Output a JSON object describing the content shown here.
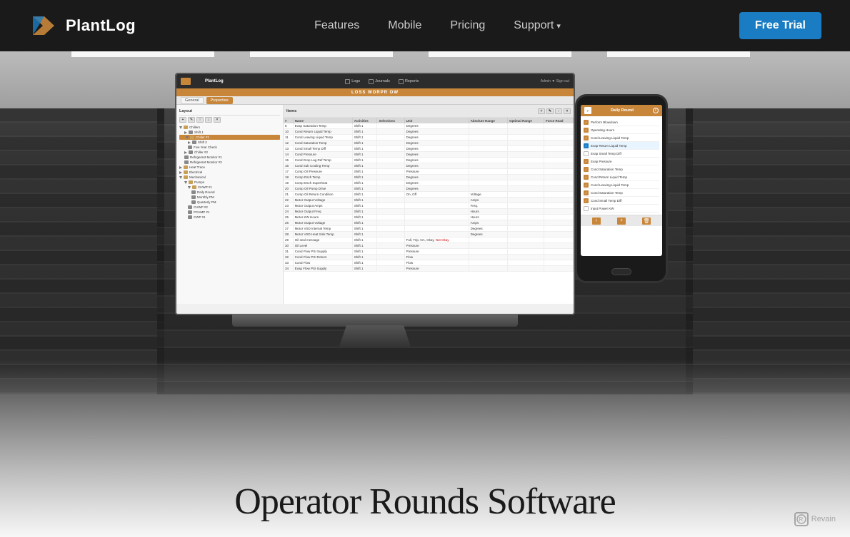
{
  "nav": {
    "logo_text": "PlantLog",
    "links": [
      {
        "label": "Features",
        "id": "features"
      },
      {
        "label": "Mobile",
        "id": "mobile"
      },
      {
        "label": "Pricing",
        "id": "pricing"
      },
      {
        "label": "Support",
        "id": "support"
      }
    ],
    "cta_label": "Free Trial"
  },
  "app": {
    "brand": "PlantLog",
    "nav_items": [
      {
        "label": "Logs",
        "icon": "log-icon"
      },
      {
        "label": "Journals",
        "icon": "journal-icon"
      },
      {
        "label": "Reports",
        "icon": "report-icon"
      }
    ],
    "admin_label": "Admin ▼  Sign out",
    "title_bar": "LOSS WORPR OW",
    "tabs": [
      {
        "label": "General",
        "active": false
      },
      {
        "label": "Properties",
        "active": true
      }
    ],
    "layout_section": "Layout",
    "items_section": "Items",
    "tree": [
      {
        "label": "Chillers",
        "level": 0,
        "type": "folder",
        "open": true
      },
      {
        "label": "Shift 1",
        "level": 1,
        "type": "item"
      },
      {
        "label": "Chiller #1",
        "level": 1,
        "type": "item",
        "selected": true
      },
      {
        "label": "Shift 2",
        "level": 2,
        "type": "item"
      },
      {
        "label": "Five Year Check",
        "level": 2,
        "type": "item"
      },
      {
        "label": "Chiller #2",
        "level": 1,
        "type": "item"
      },
      {
        "label": "Refrigerant Monitor #1",
        "level": 1,
        "type": "item"
      },
      {
        "label": "Refrigerant Monitor #2",
        "level": 1,
        "type": "item"
      },
      {
        "label": "Heat Trace",
        "level": 0,
        "type": "folder"
      },
      {
        "label": "Electrical",
        "level": 0,
        "type": "folder"
      },
      {
        "label": "Mechanical",
        "level": 0,
        "type": "folder"
      },
      {
        "label": "Pumps",
        "level": 1,
        "type": "folder",
        "open": true
      },
      {
        "label": "CHWP #1",
        "level": 2,
        "type": "folder",
        "open": true
      },
      {
        "label": "Daily Round",
        "level": 3,
        "type": "item"
      },
      {
        "label": "Monthly PM",
        "level": 3,
        "type": "item"
      },
      {
        "label": "Quarterly PM",
        "level": 3,
        "type": "item"
      },
      {
        "label": "CHWP #2",
        "level": 2,
        "type": "item"
      },
      {
        "label": "PCHMP #1",
        "level": 2,
        "type": "item"
      },
      {
        "label": "CWP #1",
        "level": 2,
        "type": "item"
      }
    ],
    "table_headers": [
      "#",
      "Name",
      "Activities",
      "Selections",
      "Unit",
      "Absolute Range",
      "Optimal Range",
      "Force Read"
    ],
    "table_rows": [
      [
        "8",
        "Evap Saturation Temp",
        "Shift 1",
        "",
        "Degrees",
        "",
        "",
        ""
      ],
      [
        "10",
        "Cond Return Liquid Temp",
        "Shift 1",
        "",
        "Degrees",
        "",
        "",
        ""
      ],
      [
        "11",
        "Cond Leaving Liquid Temp",
        "Shift 1",
        "",
        "Degrees",
        "",
        "",
        ""
      ],
      [
        "12",
        "Cond Saturation Temp",
        "Shift 1",
        "",
        "Degrees",
        "",
        "",
        ""
      ],
      [
        "13",
        "Cond Small Temp Diff",
        "Shift 1",
        "",
        "Degrees",
        "",
        "",
        ""
      ],
      [
        "14",
        "Cond Pressure",
        "Shift 1",
        "",
        "Degrees",
        "",
        "",
        ""
      ],
      [
        "15",
        "Cond Drop Lag Ref Temp",
        "Shift 1",
        "",
        "Degrees",
        "",
        "",
        ""
      ],
      [
        "16",
        "Cond Sub Cooling Temp",
        "Shift 1",
        "",
        "Degrees",
        "",
        "",
        ""
      ],
      [
        "17",
        "Comp Oil Pressure",
        "Shift 1",
        "",
        "Pressure",
        "",
        "",
        ""
      ],
      [
        "18",
        "Comp Dsch Temp",
        "Shift 1",
        "",
        "Degrees",
        "",
        "",
        ""
      ],
      [
        "19",
        "Comp Dsch Superheat",
        "Shift 1",
        "",
        "Degrees",
        "",
        "",
        ""
      ],
      [
        "20",
        "Comp Oil Pump Drive",
        "Shift 1",
        "",
        "Degrees",
        "",
        "",
        ""
      ],
      [
        "21",
        "Comp Oil Return Condition",
        "Shift 1",
        "",
        "On, Off",
        "Voltage",
        "",
        ""
      ],
      [
        "22",
        "Motor Output Voltage",
        "Shift 1",
        "",
        "",
        "Amps",
        "",
        ""
      ],
      [
        "23",
        "Motor Output Amps",
        "Shift 1",
        "",
        "",
        "Freq.",
        "",
        ""
      ],
      [
        "24",
        "Motor Output Freq",
        "Shift 1",
        "",
        "",
        "Hours",
        "",
        ""
      ],
      [
        "25",
        "Motor KW Hours",
        "Shift 1",
        "",
        "",
        "Hours",
        "",
        ""
      ],
      [
        "26",
        "Motor Output Voltage",
        "Shift 1",
        "",
        "",
        "Amps",
        "",
        ""
      ],
      [
        "27",
        "Motor VSD Internal Temp",
        "Shift 1",
        "",
        "",
        "Degrees",
        "",
        ""
      ],
      [
        "28",
        "Motor VSD Heat Sink Temp",
        "Shift 1",
        "",
        "",
        "Degrees",
        "",
        ""
      ],
      [
        "29",
        "Oil seal message",
        "Shift 1",
        "",
        "Full, Trip, NA, Okay, Not Okay",
        "",
        "",
        ""
      ],
      [
        "30",
        "Oil Level",
        "Shift 1",
        "",
        "Pressure",
        "",
        "",
        ""
      ],
      [
        "31",
        "Cond Flow PSI Supply",
        "Shift 1",
        "",
        "Pressure",
        "",
        "",
        ""
      ],
      [
        "32",
        "Cond Flow PSI Return",
        "Shift 1",
        "",
        "Flow",
        "",
        "",
        ""
      ],
      [
        "33",
        "Cond Flow",
        "Shift 1",
        "",
        "Flow",
        "",
        "",
        ""
      ],
      [
        "34",
        "Evap Flow PSI Supply",
        "Shift 1",
        "",
        "Pressure",
        "",
        "",
        ""
      ]
    ]
  },
  "phone": {
    "header": "Daily Round",
    "checklist": [
      {
        "label": "Perform Blowdown",
        "checked": true,
        "type": "orange"
      },
      {
        "label": "Operating Hours",
        "checked": true,
        "type": "orange"
      },
      {
        "label": "Cond Leaving Liquid Temp",
        "checked": true,
        "type": "orange"
      },
      {
        "label": "Evap Return Liquid Temp",
        "checked": true,
        "type": "blue",
        "selected": true
      },
      {
        "label": "Evap Small Temp Diff",
        "checked": false
      },
      {
        "label": "Evap Pressure",
        "checked": true,
        "type": "orange"
      },
      {
        "label": "Cond Saturation Temp",
        "checked": true,
        "type": "orange"
      },
      {
        "label": "Cond Return Liquid Temp",
        "checked": true,
        "type": "orange"
      },
      {
        "label": "Cond Leaving Liquid Temp",
        "checked": true,
        "type": "orange"
      },
      {
        "label": "Cond Saturation Temp",
        "checked": true,
        "type": "orange"
      },
      {
        "label": "Cond Small Temp Diff",
        "checked": true,
        "type": "orange"
      },
      {
        "label": "Input Power KW",
        "checked": false
      }
    ]
  },
  "headline": {
    "text": "Operator Rounds Software"
  },
  "revain": {
    "icon": "R",
    "label": "Revain"
  }
}
